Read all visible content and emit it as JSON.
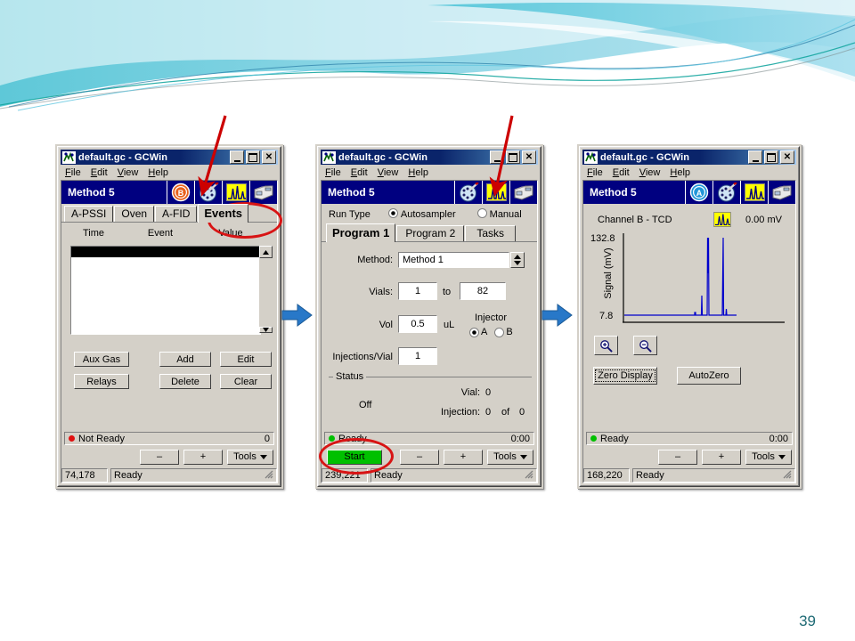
{
  "slide": {
    "page_number": "39"
  },
  "common": {
    "title": "default.gc - GCWin",
    "menu": [
      "File",
      "Edit",
      "View",
      "Help"
    ],
    "minimize_label": "_",
    "maximize_label": "□",
    "close_label": "×",
    "method_name": "Method 5",
    "tools_label": "Tools",
    "minus_label": "–",
    "plus_label": "+",
    "ready_label": "Ready"
  },
  "window1": {
    "title": "default.gc - GCWin",
    "method_name": "Method 5",
    "icons": [
      "detector-b-icon",
      "palette-injector-icon",
      "chromatogram-icon",
      "instrument-icon"
    ],
    "tabs": [
      {
        "label": "A-PSSI",
        "selected": false
      },
      {
        "label": "Oven",
        "selected": false
      },
      {
        "label": "A-FID",
        "selected": false
      },
      {
        "label": "Events",
        "selected": true
      }
    ],
    "table": {
      "columns": [
        "Time",
        "Event",
        "Value"
      ],
      "rows": []
    },
    "buttons": [
      "Aux Gas",
      "Add",
      "Edit",
      "Relays",
      "Delete",
      "Clear"
    ],
    "status": {
      "text": "Not Ready",
      "led_color": "#e01010",
      "right": "0"
    },
    "bottom_buttons": [
      "–",
      "+",
      "Tools"
    ],
    "statusbar": {
      "coords": "74,178",
      "state": "Ready"
    }
  },
  "window2": {
    "title": "default.gc - GCWin",
    "method_name": "Method 5",
    "icons": [
      "palette-injector-icon",
      "chromatogram-icon",
      "instrument-icon"
    ],
    "run_type": {
      "label": "Run Type",
      "options": [
        {
          "label": "Autosampler",
          "selected": true
        },
        {
          "label": "Manual",
          "selected": false
        }
      ]
    },
    "tabs": [
      {
        "label": "Program 1",
        "selected": true
      },
      {
        "label": "Program 2",
        "selected": false
      },
      {
        "label": "Tasks",
        "selected": false
      }
    ],
    "fields": {
      "method_label": "Method:",
      "method_value": "Method 1",
      "vials_label": "Vials:",
      "vials_from": "1",
      "vials_to_label": "to",
      "vials_to": "82",
      "vol_label": "Vol",
      "vol_value": "0.5",
      "vol_units": "uL",
      "injector_label": "Injector",
      "injector_options": [
        {
          "label": "A",
          "selected": true
        },
        {
          "label": "B",
          "selected": false
        }
      ],
      "injections_label": "Injections/Vial",
      "injections_value": "1"
    },
    "status_group": {
      "legend": "Status",
      "state": "Off",
      "vial_label": "Vial:",
      "vial_value": "0",
      "injection_label": "Injection:",
      "injection_value": "0",
      "of_label": "of",
      "injection_total": "0"
    },
    "status": {
      "text": "Ready",
      "led_color": "#00c000",
      "right": "0:00"
    },
    "start_button": "Start",
    "bottom_buttons": [
      "–",
      "+",
      "Tools"
    ],
    "statusbar": {
      "coords": "239,221",
      "state": "Ready"
    }
  },
  "window3": {
    "title": "default.gc - GCWin",
    "method_name": "Method 5",
    "icons": [
      "detector-a-icon",
      "palette-injector-icon",
      "chromatogram-icon",
      "instrument-icon"
    ],
    "channel_label": "Channel B - TCD",
    "signal_readout": "0.00 mV",
    "buttons": {
      "zoom_in": "zoom-in-icon",
      "zoom_out": "zoom-out-icon",
      "zero_display": "Zero Display",
      "autozero": "AutoZero"
    },
    "status": {
      "text": "Ready",
      "led_color": "#00c000",
      "right": "0:00"
    },
    "bottom_buttons": [
      "–",
      "+",
      "Tools"
    ],
    "statusbar": {
      "coords": "168,220",
      "state": "Ready"
    }
  },
  "chart_data": {
    "type": "line",
    "title": "Channel B - TCD",
    "xlabel": "",
    "ylabel": "Signal (mV)",
    "ylim": [
      7.8,
      132.8
    ],
    "ytick_labels": [
      "132.8",
      "7.8"
    ],
    "grid": false,
    "legend": "none",
    "trace_color": "#0000cc",
    "peaks": [
      {
        "x": 0.455,
        "height_frac": 0.04
      },
      {
        "x": 0.505,
        "height_frac": 0.22
      },
      {
        "x": 0.555,
        "height_frac": 1.0
      },
      {
        "x": 0.565,
        "height_frac": 0.62
      },
      {
        "x": 0.645,
        "height_frac": 1.0
      },
      {
        "x": 0.655,
        "height_frac": 0.1
      }
    ],
    "baseline_frac": 0.03,
    "trace_end_x": 0.7
  },
  "annotations": {
    "arrow_color": "#cc0000",
    "ellipse_color": "#d81414",
    "flow_arrow_color": "#2878c8",
    "items": [
      {
        "name": "arrow-to-palette-icon",
        "target": "window1-palette-icon"
      },
      {
        "name": "ellipse-events-tab",
        "target": "window1-events-tab"
      },
      {
        "name": "arrow-to-chromatogram-icon",
        "target": "window2-chromatogram-icon"
      },
      {
        "name": "ellipse-start-button",
        "target": "window2-start-button"
      },
      {
        "name": "flow-arrow-1",
        "target": "between-window1-window2"
      },
      {
        "name": "flow-arrow-2",
        "target": "between-window2-window3"
      }
    ]
  }
}
